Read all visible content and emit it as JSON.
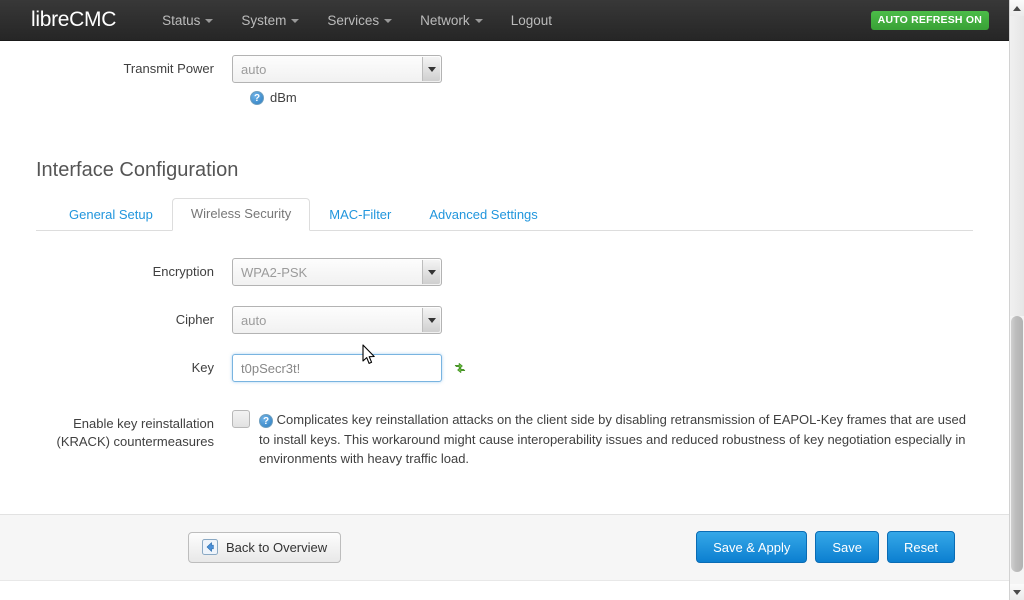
{
  "navbar": {
    "brand": "libreCMC",
    "items": [
      {
        "label": "Status",
        "has_caret": true
      },
      {
        "label": "System",
        "has_caret": true
      },
      {
        "label": "Services",
        "has_caret": true
      },
      {
        "label": "Network",
        "has_caret": true
      },
      {
        "label": "Logout",
        "has_caret": false
      }
    ],
    "refresh_badge": "AUTO REFRESH ON",
    "badge_color": "#41b03f"
  },
  "device_config": {
    "transmit_power": {
      "label": "Transmit Power",
      "value": "auto",
      "unit": "dBm",
      "help_icon": "help-question-icon"
    }
  },
  "interface_config": {
    "title": "Interface Configuration",
    "tabs": [
      {
        "label": "General Setup",
        "active": false
      },
      {
        "label": "Wireless Security",
        "active": true
      },
      {
        "label": "MAC-Filter",
        "active": false
      },
      {
        "label": "Advanced Settings",
        "active": false
      }
    ],
    "encryption": {
      "label": "Encryption",
      "value": "WPA2-PSK"
    },
    "cipher": {
      "label": "Cipher",
      "value": "auto"
    },
    "key": {
      "label": "Key",
      "value": "t0pSecr3t!",
      "placeholder": "",
      "reveal_icon": "refresh-reveal-icon",
      "focused": true
    },
    "krack": {
      "label_line1": "Enable key reinstallation",
      "label_line2": "(KRACK) countermeasures",
      "checked": false,
      "help_icon": "help-question-icon",
      "description": "Complicates key reinstallation attacks on the client side by disabling retransmission of EAPOL-Key frames that are used to install keys. This workaround might cause interoperability issues and reduced robustness of key negotiation especially in environments with heavy traffic load."
    }
  },
  "footer": {
    "back_label": "Back to Overview",
    "back_icon": "back-arrow-icon",
    "save_apply_label": "Save & Apply",
    "save_label": "Save",
    "reset_label": "Reset",
    "button_color": "#0c7fd0"
  }
}
